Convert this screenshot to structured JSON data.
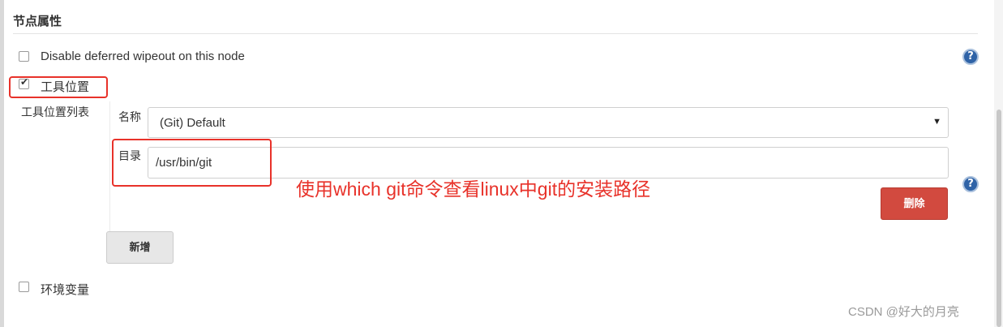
{
  "section": {
    "title": "节点属性"
  },
  "deferred_wipeout": {
    "label": "Disable deferred wipeout on this node",
    "checked": false
  },
  "help_glyph": "?",
  "tool_locations": {
    "label": "工具位置",
    "checked": true,
    "list_label": "工具位置列表",
    "name_label": "名称",
    "name_value": "(Git) Default",
    "dropdown_arrow": "▼",
    "dir_label": "目录",
    "dir_value": "/usr/bin/git",
    "delete_label": "删除",
    "add_label": "新增"
  },
  "annotation": {
    "text": "使用which git命令查看linux中git的安装路径",
    "color": "#e8322a"
  },
  "env_vars": {
    "label": "环境变量",
    "checked": false
  },
  "watermark": "CSDN @好大的月亮",
  "colors": {
    "accent_red": "#d24a3f",
    "help_blue": "#2f63a7",
    "annotation_red": "#e8322a"
  }
}
